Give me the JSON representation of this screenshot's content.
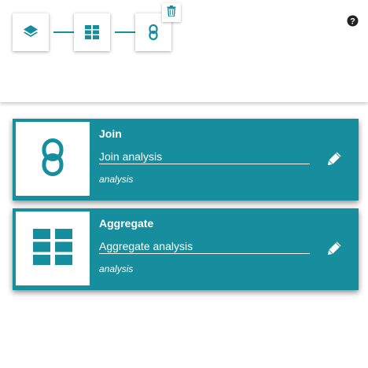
{
  "colors": {
    "accent": "#168e9e",
    "card_background": "#168e9e",
    "text_on_accent": "#ffffff",
    "help_icon": "#222222"
  },
  "pipeline": {
    "steps": [
      {
        "icon": "layers-icon"
      },
      {
        "icon": "table-grid-icon"
      },
      {
        "icon": "chain-link-icon"
      }
    ],
    "delete_icon": "trash-icon",
    "help_icon": "question-circle-icon"
  },
  "cards": [
    {
      "title": "Join",
      "description": "Join analysis",
      "type": "analysis",
      "icon": "chain-link-icon",
      "edit_icon": "pencil-icon"
    },
    {
      "title": "Aggregate",
      "description": "Aggregate analysis",
      "type": "analysis",
      "icon": "table-grid-icon",
      "edit_icon": "pencil-icon"
    }
  ]
}
